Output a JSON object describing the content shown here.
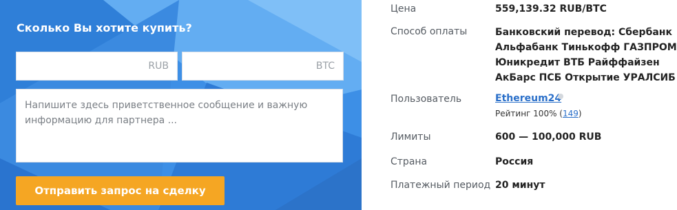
{
  "buy_form": {
    "title": "Сколько Вы хотите купить?",
    "rub_placeholder": "RUB",
    "btc_placeholder": "BTC",
    "message_placeholder": "Напишите здесь приветственное сообщение и важную информацию для партнера ...",
    "submit_label": "Отправить запрос на сделку",
    "colors": {
      "panel": "#3d8fe6",
      "button": "#f5a623"
    }
  },
  "details": {
    "price_label": "Цена",
    "price_value": "559,139.32 RUB/BTC",
    "payment_label": "Способ оплаты",
    "payment_value": "Банковский перевод: Сбербанк Альфабанк Тинькофф ГАЗПРОМ Юникредит ВТБ Райффайзен АкБарс ПСБ Открытие УРАЛСИБ",
    "user_label": "Пользователь",
    "user_name": "Ethereum24",
    "rating_prefix": "Рейтинг 100% (",
    "rating_count": "149",
    "rating_suffix": ")",
    "limits_label": "Лимиты",
    "limits_value": "600 — 100,000 RUB",
    "country_label": "Страна",
    "country_value": "Россия",
    "period_label": "Платежный период",
    "period_value": "20 минут"
  }
}
